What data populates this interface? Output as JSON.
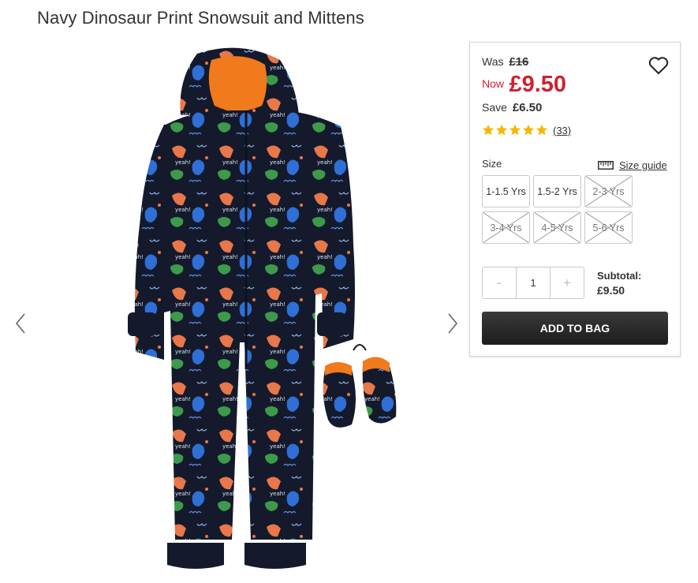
{
  "product": {
    "title": "Navy Dinosaur Print Snowsuit and Mittens"
  },
  "gallery": {
    "prev_icon": "chevron-left-icon",
    "next_icon": "chevron-right-icon"
  },
  "pricing": {
    "was_label": "Was",
    "was_price": "£16",
    "now_label": "Now",
    "now_price": "£9.50",
    "save_label": "Save",
    "save_amount": "£6.50",
    "sale_color": "#d0202e"
  },
  "wishlist": {
    "icon": "heart-icon"
  },
  "rating": {
    "stars": 5,
    "star_color": "#f5b800",
    "review_count": "(33)"
  },
  "size": {
    "label": "Size",
    "guide_label": "Size guide",
    "guide_icon": "ruler-icon",
    "options": [
      {
        "label": "1-1.5 Yrs",
        "available": true
      },
      {
        "label": "1.5-2 Yrs",
        "available": true
      },
      {
        "label": "2-3 Yrs",
        "available": false
      },
      {
        "label": "3-4 Yrs",
        "available": false
      },
      {
        "label": "4-5 Yrs",
        "available": false
      },
      {
        "label": "5-6 Yrs",
        "available": false
      }
    ]
  },
  "quantity": {
    "minus": "-",
    "value": "1",
    "plus": "+"
  },
  "subtotal": {
    "label": "Subtotal:",
    "value": "£9.50"
  },
  "cart": {
    "add_label": "ADD TO BAG"
  }
}
